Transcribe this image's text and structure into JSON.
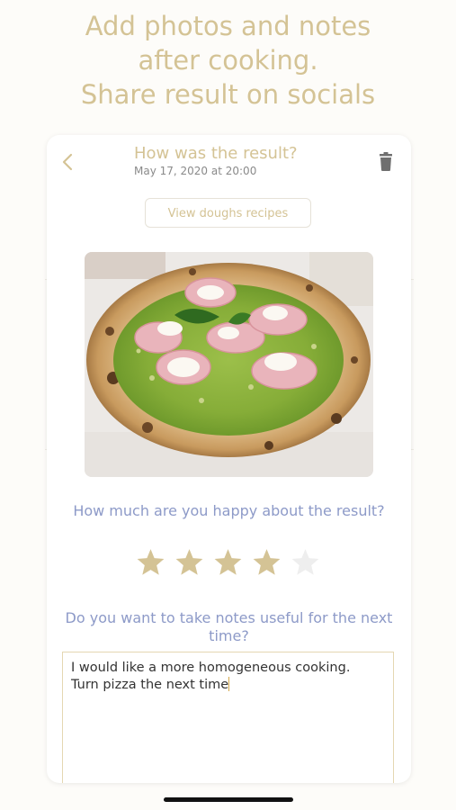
{
  "promo": {
    "line1": "Add photos and notes",
    "line2": "after cooking.",
    "line3": "Share result on socials"
  },
  "header": {
    "title": "How was the result?",
    "date": "May 17, 2020 at 20:00",
    "back_icon": "chevron-left-icon",
    "delete_icon": "trash-icon"
  },
  "doughs_button": {
    "label": "View doughs recipes"
  },
  "photo": {
    "description_icon": "pizza-photo"
  },
  "rating": {
    "question": "How much are you happy about the result?",
    "value": 4,
    "max": 5
  },
  "notes": {
    "question": "Do you want to take notes useful for the next time?",
    "value_line1": "I would like a more homogeneous cooking.",
    "value_line2": "Turn pizza the next time"
  },
  "colors": {
    "accent_gold": "#d4c395",
    "question_blue": "#8d9ac8",
    "star_filled": "#d4c395",
    "star_empty": "#eeeeee"
  }
}
